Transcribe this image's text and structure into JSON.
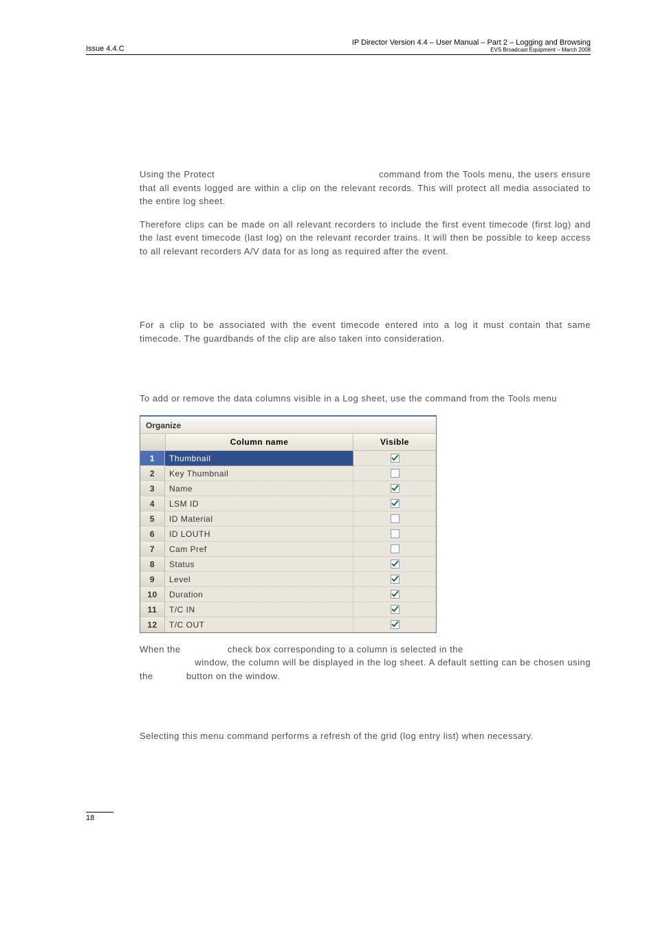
{
  "header": {
    "issue": "Issue 4.4.C",
    "title": "IP Director Version 4.4 – User Manual – Part 2 – Logging and Browsing",
    "sub": "EVS Broadcast Equipment – March 2008"
  },
  "body": {
    "p1_a": "Using the Protect",
    "p1_b": "command from the Tools menu, the users ensure that all events logged are within a clip on the relevant records. This will protect all media associated to the entire log sheet.",
    "p2": "Therefore clips can be made on all relevant recorders to include the first event timecode (first log) and the last event timecode (last log) on the relevant recorder trains. It will then be possible to keep access to all relevant recorders A/V data for as long as required after the event.",
    "p3": "For a clip to be associated with the event timecode entered into a log it must contain that same timecode. The guardbands of the clip are also taken into consideration.",
    "p4": "To add or remove the data columns visible in a Log sheet, use the command from the Tools menu",
    "p5_a": "When  the",
    "p5_b": "check box corresponding to a column is selected in the",
    "p5_c": "window, the column will be displayed in the log sheet. A default setting can be chosen using the",
    "p5_d": "button on the window.",
    "p6": "Selecting this menu command performs a refresh of the grid (log entry list) when necessary."
  },
  "organize": {
    "title": "Organize",
    "col_name_header": "Column name",
    "visible_header": "Visible",
    "rows": [
      {
        "n": "1",
        "name": "Thumbnail",
        "checked": true,
        "selected": true
      },
      {
        "n": "2",
        "name": "Key Thumbnail",
        "checked": false,
        "selected": false
      },
      {
        "n": "3",
        "name": "Name",
        "checked": true,
        "selected": false
      },
      {
        "n": "4",
        "name": "LSM ID",
        "checked": true,
        "selected": false
      },
      {
        "n": "5",
        "name": "ID Material",
        "checked": false,
        "selected": false
      },
      {
        "n": "6",
        "name": "ID LOUTH",
        "checked": false,
        "selected": false
      },
      {
        "n": "7",
        "name": "Cam Pref",
        "checked": false,
        "selected": false
      },
      {
        "n": "8",
        "name": "Status",
        "checked": true,
        "selected": false
      },
      {
        "n": "9",
        "name": "Level",
        "checked": true,
        "selected": false
      },
      {
        "n": "10",
        "name": "Duration",
        "checked": true,
        "selected": false
      },
      {
        "n": "11",
        "name": "T/C IN",
        "checked": true,
        "selected": false
      },
      {
        "n": "12",
        "name": "T/C OUT",
        "checked": true,
        "selected": false
      }
    ]
  },
  "footer": {
    "page": "18"
  }
}
